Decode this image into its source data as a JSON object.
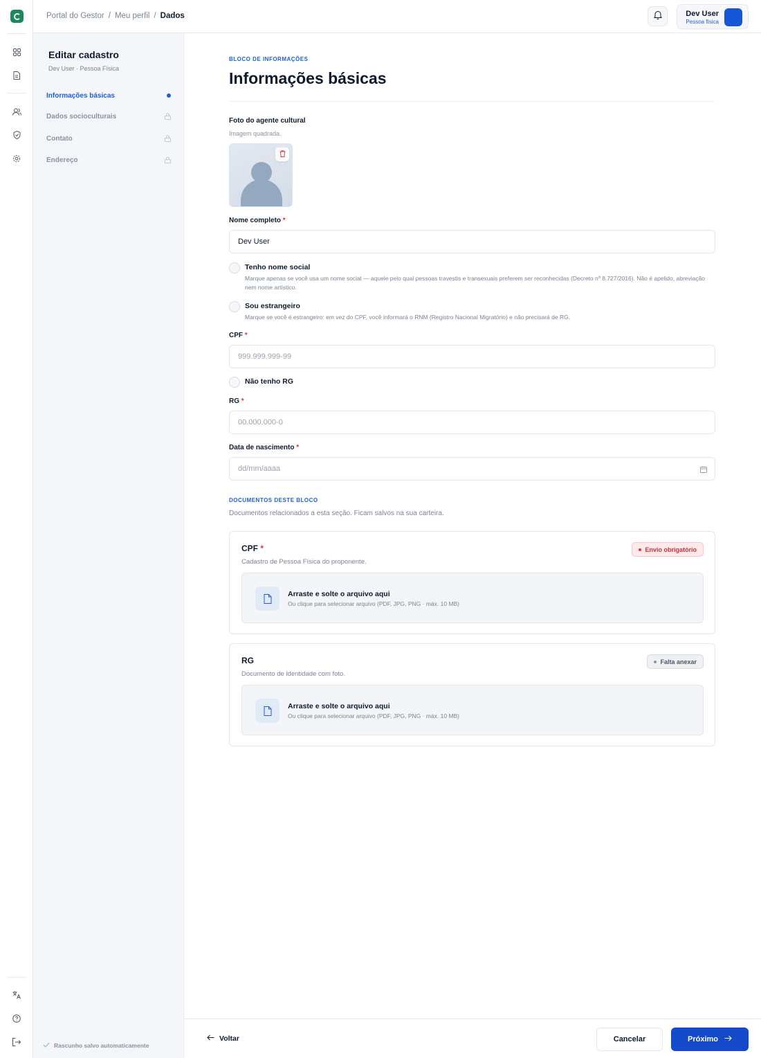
{
  "breadcrumb": [
    "Portal do Gestor",
    "Meu perfil",
    "Dados"
  ],
  "breadcrumb_sep": "/",
  "user": {
    "name": "Dev User",
    "type": "Pessoa física"
  },
  "sidebar": {
    "title": "Editar cadastro",
    "subtitle": "Dev User · Pessoa Física",
    "items": [
      {
        "label": "Informações básicas",
        "state": "active"
      },
      {
        "label": "Dados socioculturais",
        "state": "locked"
      },
      {
        "label": "Contato",
        "state": "locked"
      },
      {
        "label": "Endereço",
        "state": "locked"
      }
    ],
    "draft_status": "Rascunho salvo automaticamente"
  },
  "main": {
    "eyebrow": "BLOCO DE INFORMAÇÕES",
    "title": "Informações básicas",
    "photo": {
      "label": "Foto do agente cultural",
      "hint": "Imagem quadrada."
    },
    "full_name": {
      "label": "Nome completo",
      "value": "Dev User"
    },
    "social_name": {
      "title": "Tenho nome social",
      "desc": "Marque apenas se você usa um nome social — aquele pelo qual pessoas travestis e transexuais preferem ser reconhecidas (Decreto nº 8.727/2016). Não é apelido, abreviação nem nome artístico."
    },
    "foreigner": {
      "title": "Sou estrangeiro",
      "desc": "Marque se você é estrangeiro: em vez do CPF, você informará o RNM (Registro Nacional Migratório) e não precisará de RG."
    },
    "cpf": {
      "label": "CPF",
      "placeholder": "999.999.999-99"
    },
    "no_rg": {
      "title": "Não tenho RG"
    },
    "rg": {
      "label": "RG",
      "placeholder": "00.000.000-0"
    },
    "birth": {
      "label": "Data de nascimento",
      "placeholder": "dd/mm/aaaa"
    },
    "required_mark": "*"
  },
  "documents": {
    "eyebrow": "DOCUMENTOS DESTE BLOCO",
    "subtitle": "Documentos relacionados a esta seção. Ficam salvos na sua carteira.",
    "items": [
      {
        "title": "CPF",
        "required": true,
        "desc": "Cadastro de Pessoa Física do proponente.",
        "badge": "Envio obrigatório",
        "badge_color": "#c7323d",
        "drop_title": "Arraste e solte o arquivo aqui",
        "drop_sub": "Ou clique para selecionar arquivo (PDF, JPG, PNG · máx. 10 MB)"
      },
      {
        "title": "RG",
        "required": false,
        "desc": "Documento de identidade com foto.",
        "badge": "Falta anexar",
        "badge_color": "#4e5765",
        "drop_title": "Arraste e solte o arquivo aqui",
        "drop_sub": "Ou clique para selecionar arquivo (PDF, JPG, PNG · máx. 10 MB)"
      }
    ]
  },
  "footer": {
    "back": "Voltar",
    "cancel": "Cancelar",
    "next": "Próximo"
  },
  "colors": {
    "accent": "#1f5fd6",
    "primary_button": "#1449c9",
    "brand": "#1a8a5c",
    "required": "#d63a3a"
  },
  "icons": [
    "app-logo-icon",
    "dashboard-icon",
    "document-icon",
    "users-icon",
    "shield-icon",
    "gear-icon",
    "translate-icon",
    "help-icon",
    "logout-icon",
    "bell-icon",
    "trash-icon",
    "calendar-icon",
    "file-icon",
    "lock-icon",
    "check-icon",
    "arrow-left-icon",
    "arrow-right-icon"
  ]
}
